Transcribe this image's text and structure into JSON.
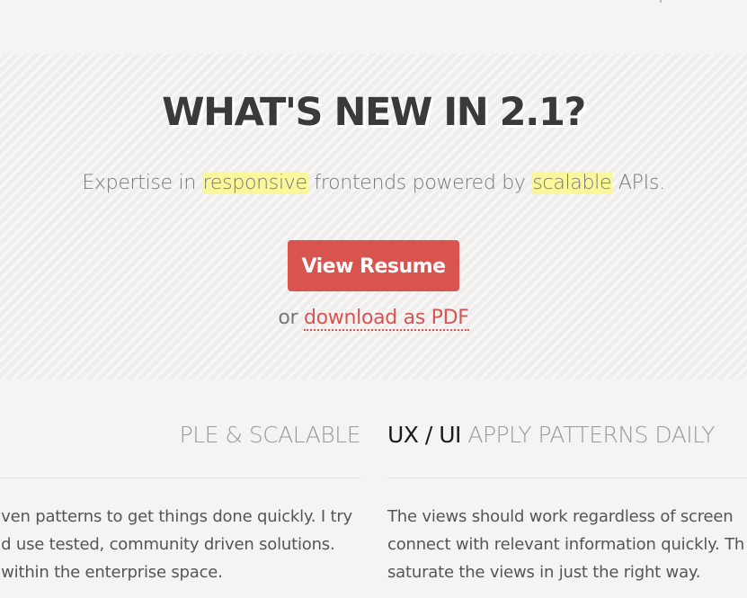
{
  "hero": {
    "title": "WHAT'S NEW IN 2.1?",
    "subtitle": {
      "part1": "Expertise in ",
      "highlight1": "responsive",
      "part2": " frontends powered by ",
      "highlight2": "scalable",
      "part3": " APIs."
    },
    "resume_button_label": "View Resume",
    "download_prefix": "or ",
    "download_link_label": "download as PDF"
  },
  "columns": [
    {
      "heading_strong": "",
      "heading_light": "PLE & SCALABLE",
      "body_lines": [
        "ven patterns to get things done quickly. I try",
        "d use tested, community driven solutions.",
        "within the enterprise space."
      ]
    },
    {
      "heading_strong": "UX / UI",
      "heading_light": "APPLY PATTERNS DAILY",
      "body_lines": [
        "The views should work regardless of screen",
        "connect with relevant information quickly. Th",
        "saturate the views in just the right way."
      ]
    }
  ],
  "colors": {
    "accent": "#d9534f",
    "highlight": "#fbf89b",
    "background": "#f5f4f3"
  }
}
